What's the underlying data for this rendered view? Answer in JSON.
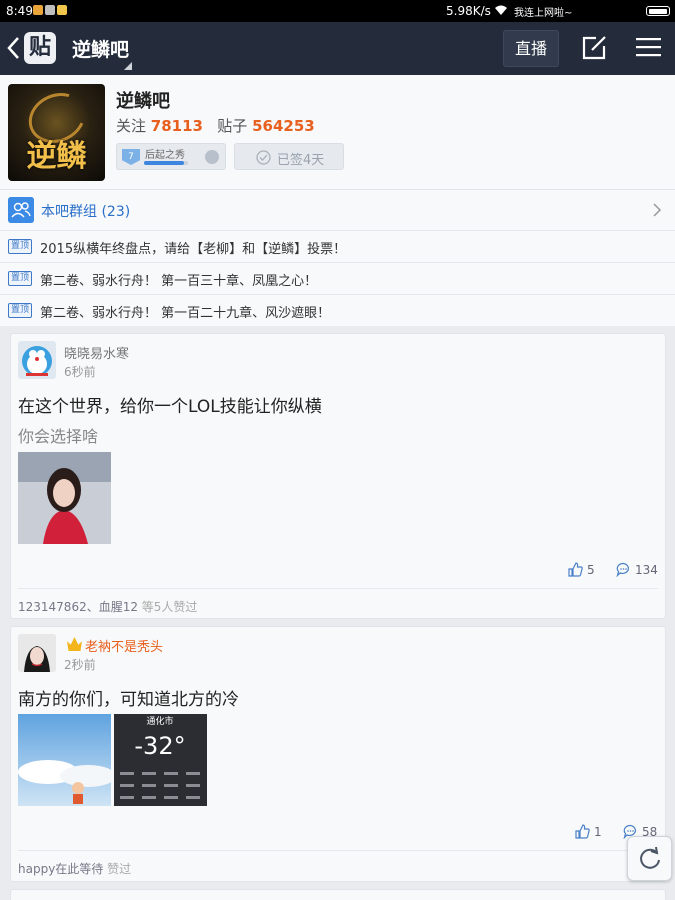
{
  "status_bar": {
    "time": "8:49",
    "speed": "5.98K/s",
    "network": "我连上网啦~"
  },
  "navbar": {
    "logo": "贴",
    "title": "逆鳞吧",
    "live_label": "直播"
  },
  "forum": {
    "name": "逆鳞吧",
    "follow_label": "关注",
    "follow_count": "78113",
    "posts_label": "贴子",
    "posts_count": "564253",
    "avatar_text": "逆鳞",
    "level": {
      "number": "7",
      "title": "后起之秀",
      "progress": 0.9
    },
    "signed_label": "已签4天"
  },
  "group": {
    "label": "本吧群组 (23)"
  },
  "top_posts": [
    {
      "tag": "置顶",
      "title": "2015纵横年终盘点，请给【老柳】和【逆鳞】投票！"
    },
    {
      "tag": "置顶",
      "title": "第二卷、弱水行舟！ 第一百三十章、凤凰之心！"
    },
    {
      "tag": "置顶",
      "title": "第二卷、弱水行舟！  第一百二十九章、风沙遮眼！"
    }
  ],
  "posts": [
    {
      "author": "晓晓易水寒",
      "time": "6秒前",
      "title": "在这个世界，给你一个LOL技能让你纵横",
      "abstract": "你会选择啥",
      "likes": "5",
      "comments": "134",
      "likers": "123147862、血腥12",
      "likers_suffix": " 等5人赞过"
    },
    {
      "author": "老衲不是秃头",
      "time": "2秒前",
      "title": "南方的你们，可知道北方的冷",
      "likes": "1",
      "comments": "58",
      "likers": "happy在此等待",
      "likers_suffix": " 赞过",
      "weather_city": "通化市",
      "weather_temp": "-32°"
    }
  ],
  "colors": {
    "nav_bg": "#242c3c",
    "accent_orange": "#e8601d",
    "link_blue": "#2a6fc9"
  }
}
